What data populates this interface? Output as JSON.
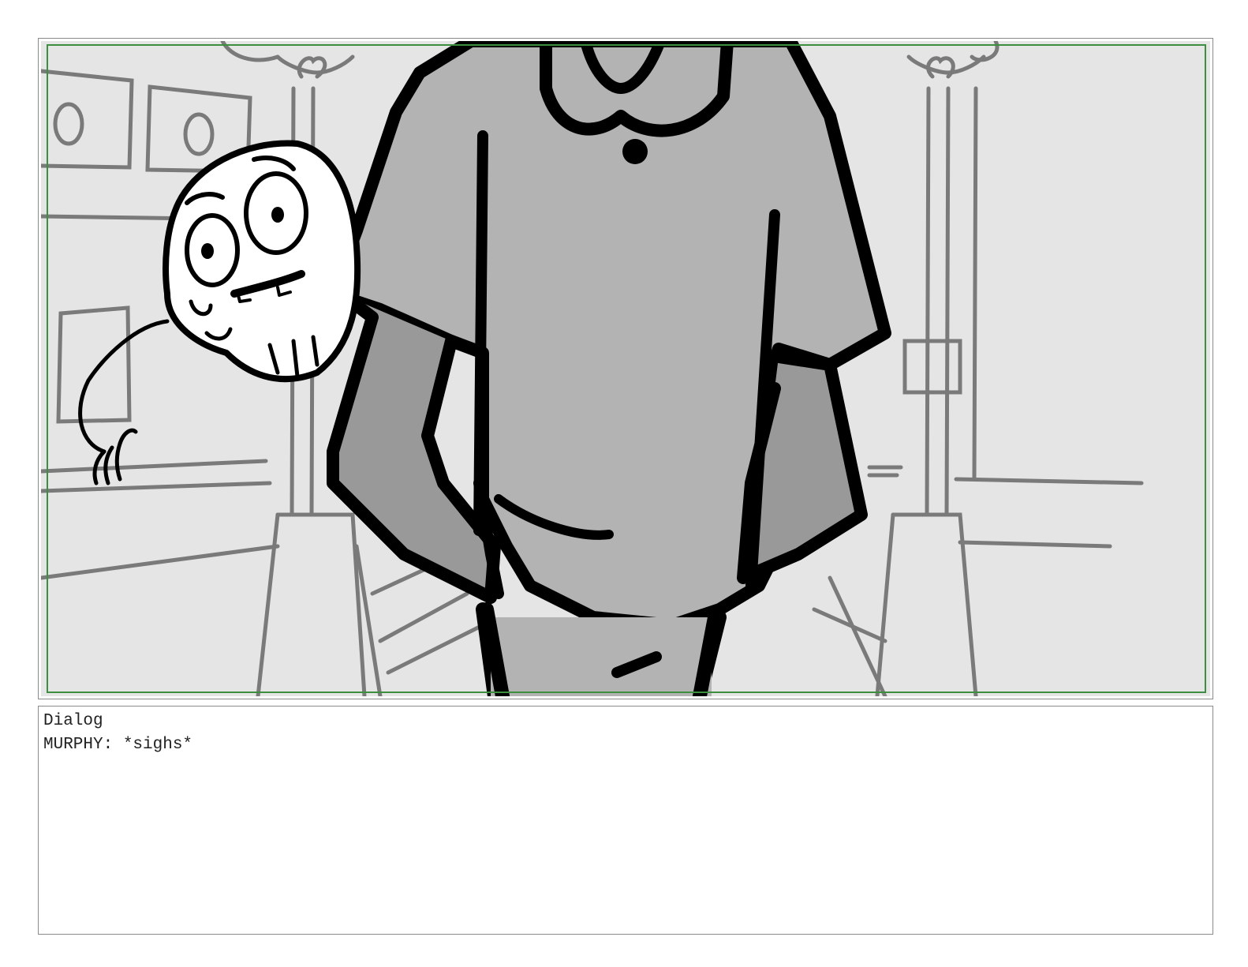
{
  "panel": {
    "frame_color": "#8a8a8a",
    "safe_area_color": "#3e8e41",
    "background_tone": "#e5e5e5",
    "shirt_tone": "#b3b3b3",
    "sleeve_tone": "#999999"
  },
  "dialog": {
    "heading": "Dialog",
    "line": "MURPHY: *sighs*"
  }
}
